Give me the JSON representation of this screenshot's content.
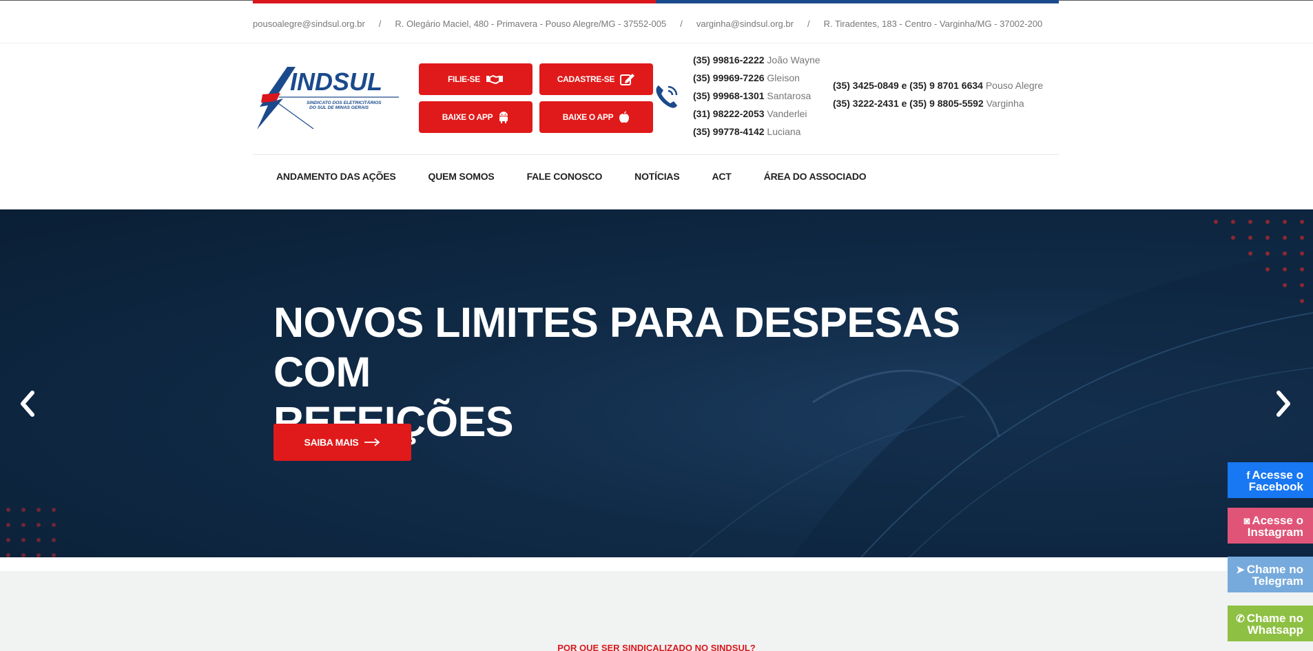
{
  "colors": {
    "brand_red": "#d9161c",
    "brand_blue": "#1b4a8c",
    "hero_bg": "#102a46"
  },
  "topbar": {
    "items": [
      "pousoalegre@sindsul.org.br",
      "R. Olegário Maciel, 480 - Primavera - Pouso Alegre/MG - 37552-005",
      "varginha@sindsul.org.br",
      "R. Tiradentes, 183 - Centro - Varginha/MG - 37002-200"
    ],
    "separator": "/"
  },
  "logo": {
    "wordmark": "SINDSUL",
    "tagline_1": "SINDICATO DOS ELETRICITÁRIOS",
    "tagline_2": "DO SUL DE MINAS GERAIS"
  },
  "buttons": {
    "filie": "FILIE-SE",
    "cadastre": "CADASTRE-SE",
    "app_android": "BAIXE O APP",
    "app_ios": "BAIXE O APP"
  },
  "contacts": [
    {
      "number": "(35) 99816-2222",
      "name": "João Wayne"
    },
    {
      "number": "(35) 99969-7226",
      "name": "Gleison"
    },
    {
      "number": "(35) 99968-1301",
      "name": "Santarosa"
    },
    {
      "number": "(31) 98222-2053",
      "name": "Vanderlei"
    },
    {
      "number": "(35) 99778-4142",
      "name": "Luciana"
    }
  ],
  "offices": [
    {
      "numbers": "(35) 3425-0849 e (35) 9 8701 6634",
      "city": "Pouso Alegre"
    },
    {
      "numbers": "(35) 3222-2431 e (35) 9 8805-5592",
      "city": "Varginha"
    }
  ],
  "nav": [
    "ANDAMENTO DAS AÇÕES",
    "QUEM SOMOS",
    "FALE CONOSCO",
    "NOTÍCIAS",
    "ACT",
    "ÁREA DO ASSOCIADO"
  ],
  "hero": {
    "title_line_1": "NOVOS LIMITES PARA DESPESAS COM",
    "title_line_2": "REFEIÇÕES",
    "button": "SAIBA MAIS"
  },
  "section": {
    "title": "POR QUE SER SINDICALIZADO NO SINDSUL?"
  },
  "social": {
    "facebook": {
      "line1": "Acesse o",
      "line2": "Facebook"
    },
    "instagram": {
      "line1": "Acesse o",
      "line2": "Instagram"
    },
    "telegram": {
      "line1": "Chame no",
      "line2": "Telegram"
    },
    "whatsapp": {
      "line1": "Chame no",
      "line2": "Whatsapp"
    }
  }
}
